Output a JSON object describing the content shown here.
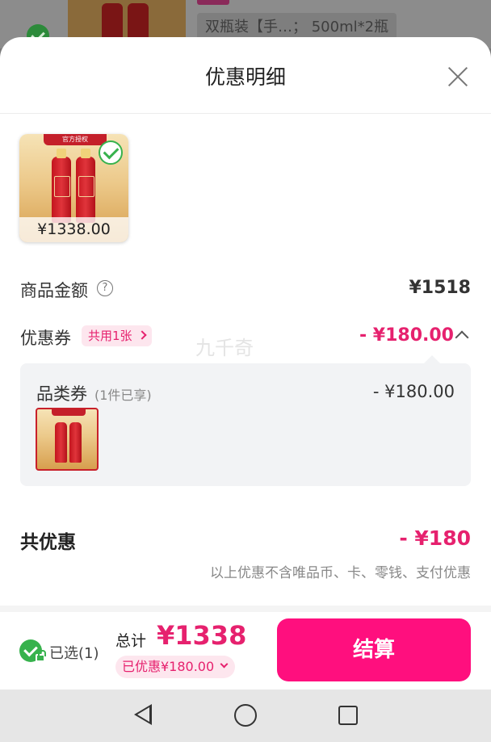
{
  "background_cart": {
    "sku_label": "双瓶装【手…； 500ml*2瓶"
  },
  "sheet": {
    "title": "优惠明细"
  },
  "product": {
    "banner_text": "官方授权",
    "price": "¥1338.00",
    "selected": true
  },
  "goods_amount": {
    "label": "商品金额",
    "value": "¥1518"
  },
  "coupon": {
    "label": "优惠券",
    "tag": "共用1张",
    "total": "- ¥180.00",
    "watermark": "九千奇"
  },
  "coupon_detail": {
    "name": "品类券",
    "count": "(1件已享)",
    "amount": "- ¥180.00"
  },
  "total_discount": {
    "label": "共优惠",
    "value": "- ¥180",
    "note": "以上优惠不含唯品币、卡、零钱、支付优惠"
  },
  "bottom_bar": {
    "selected_text": "已选(1)",
    "sum_label": "总计",
    "sum_amount": "¥1338",
    "discount_pill": "已优惠¥180.00",
    "checkout_label": "结算"
  },
  "colors": {
    "accent": "#ff0f7e",
    "price_pink": "#e6216e",
    "check_green": "#37b24d"
  },
  "icons": [
    "close-icon",
    "help-icon",
    "chevron-right-icon",
    "chevron-up-icon",
    "check-icon",
    "lock-icon",
    "chevron-down-icon",
    "nav-back-icon",
    "nav-home-icon",
    "nav-recent-icon"
  ]
}
